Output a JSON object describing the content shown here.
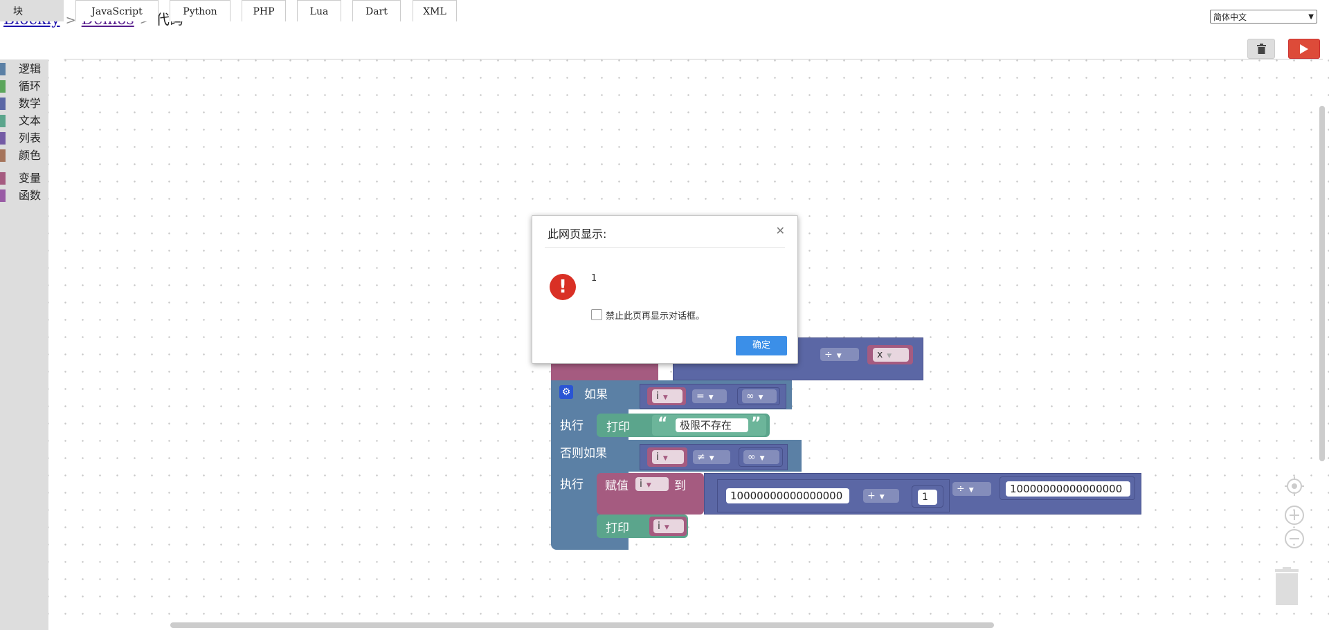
{
  "header": {
    "crumb_blockly": "Blockly",
    "crumb_demos": "Demos",
    "crumb_current": "代码",
    "separator": ">",
    "language": "简体中文"
  },
  "tabs": {
    "blocks": "块",
    "javascript": "JavaScript",
    "python": "Python",
    "php": "PHP",
    "lua": "Lua",
    "dart": "Dart",
    "xml": "XML"
  },
  "toolbar": {
    "trash_icon": "trash-icon",
    "run_icon": "play-icon"
  },
  "toolbox": [
    {
      "label": "逻辑",
      "color": "#5b80a5"
    },
    {
      "label": "循环",
      "color": "#5ba55b"
    },
    {
      "label": "数学",
      "color": "#5b67a5"
    },
    {
      "label": "文本",
      "color": "#5ba58c"
    },
    {
      "label": "列表",
      "color": "#745ba5"
    },
    {
      "label": "颜色",
      "color": "#a5745b"
    },
    {
      "label": "变量",
      "color": "#a55b80"
    },
    {
      "label": "函数",
      "color": "#995ba5"
    }
  ],
  "blocks": {
    "if_label": "如果",
    "do_label": "执行",
    "elseif_label": "否则如果",
    "do2_label": "执行",
    "print_label": "打印",
    "print2_label": "打印",
    "assign_label": "赋值",
    "to_label": "到",
    "var_i": "i",
    "var_x": "x",
    "op_eq": "=",
    "op_neq": "≠",
    "op_div": "÷",
    "op_plus": "+",
    "infinity": "∞",
    "text_open_quote": "“",
    "text_close_quote": "”",
    "text_value": "极限不存在",
    "num_big1": "10000000000000000",
    "num_one": "1",
    "num_big2": "10000000000000000"
  },
  "dialog": {
    "title": "此网页显示:",
    "message": "1",
    "checkbox_label": "禁止此页再显示对话框。",
    "ok": "确定",
    "close_icon": "close-icon",
    "alert_icon": "error-icon"
  }
}
